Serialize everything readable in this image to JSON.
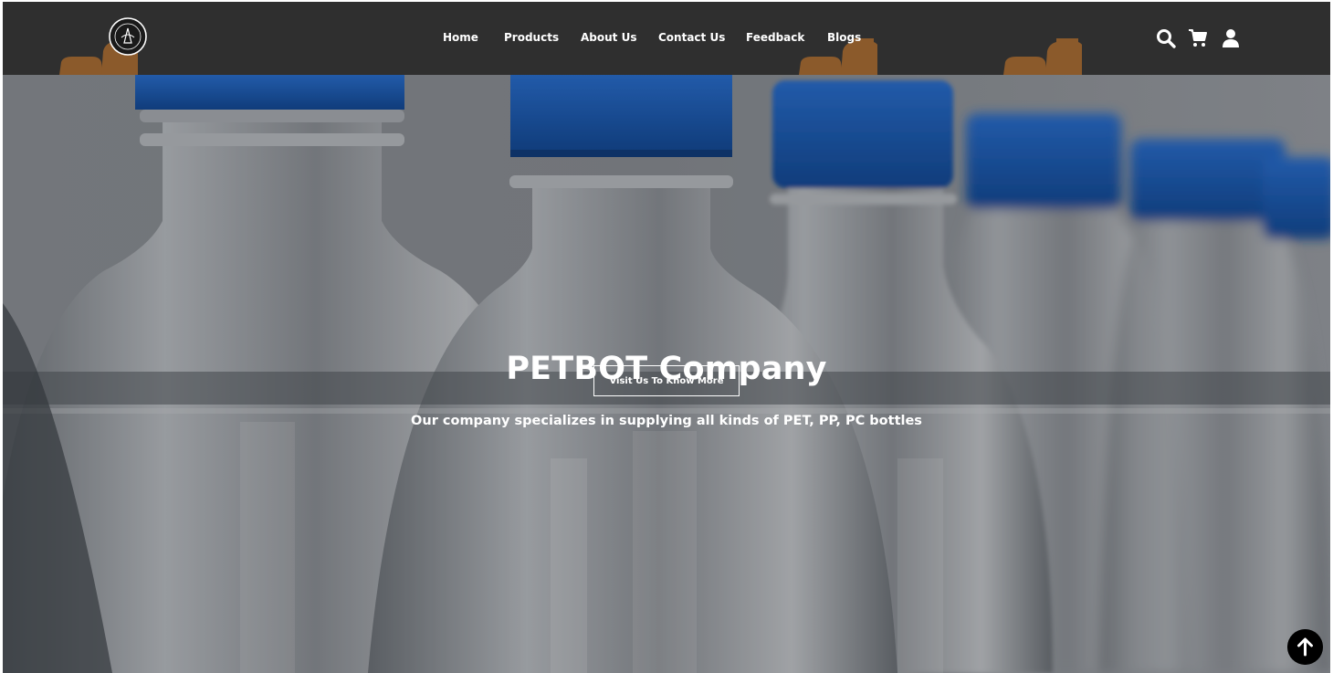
{
  "header": {
    "logo_name": "PET BOTTLE company logo",
    "nav": [
      "Home",
      "Products",
      "About Us",
      "Contact Us",
      "Feedback",
      "Blogs"
    ],
    "icons": [
      "search-icon",
      "cart-icon",
      "user-icon"
    ],
    "background_color": "#2f2f2f",
    "decor_color": "#8b5a2b"
  },
  "hero": {
    "title": "PETBOT Company",
    "subtitle": "Our company specializes in supplying all kinds of PET, PP, PC bottles",
    "button_label": "Visit Us To Know More",
    "cap_color": "#1f5fb3"
  },
  "scroll_top": {
    "icon": "arrow-up-icon"
  }
}
